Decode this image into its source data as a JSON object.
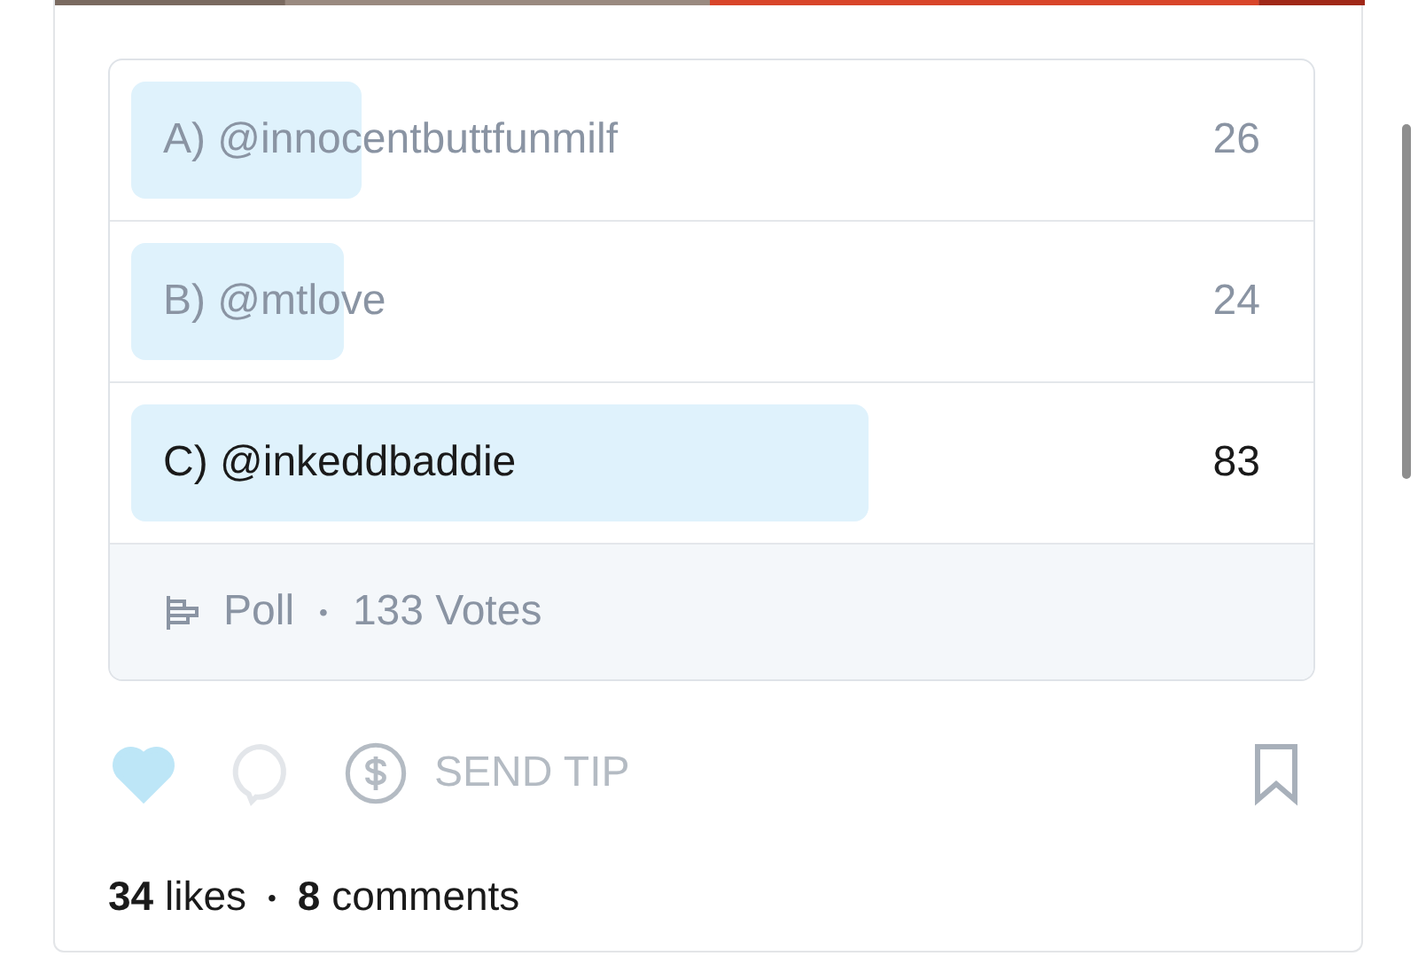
{
  "poll": {
    "options": [
      {
        "label": "A) @innocentbuttfunmilf",
        "count": "26",
        "selected": false
      },
      {
        "label": "B) @mtlove",
        "count": "24",
        "selected": false
      },
      {
        "label": "C) @inkeddbaddie",
        "count": "83",
        "selected": true
      }
    ],
    "footer": {
      "type": "Poll",
      "separator": "•",
      "votes": "133 Votes"
    }
  },
  "actions": {
    "liked": true,
    "tip_label": "SEND TIP",
    "tip_disabled": true
  },
  "stats": {
    "likes_count": "34",
    "likes_word": "likes",
    "separator": "•",
    "comments_count": "8",
    "comments_word": "comments"
  }
}
